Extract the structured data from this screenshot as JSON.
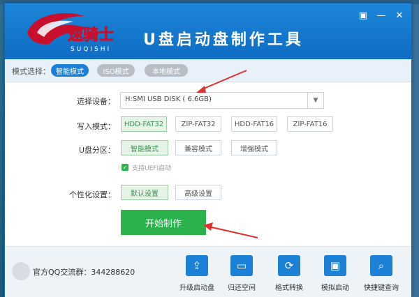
{
  "window": {
    "title": "U盘启动盘制作工具",
    "brand_text": "速骑士",
    "brand_sub": "SUQISHI",
    "controls": {
      "menu": "▣",
      "minimize": "—",
      "close": "✕"
    }
  },
  "mode_bar": {
    "label": "模式选择：",
    "tabs": [
      {
        "label": "智能模式",
        "active": true
      },
      {
        "label": "ISO模式",
        "active": false
      },
      {
        "label": "本地模式",
        "active": false
      }
    ]
  },
  "form": {
    "device_label": "选择设备：",
    "device_value": "H:SMI USB DISK ( 6.6GB)",
    "write_label": "写入模式：",
    "write_options": [
      "HDD-FAT32",
      "ZIP-FAT32",
      "HDD-FAT16",
      "ZIP-FAT16"
    ],
    "write_selected": "HDD-FAT32",
    "partition_label": "U盘分区：",
    "partition_options": [
      "智能模式",
      "兼容模式",
      "增强模式"
    ],
    "partition_selected": "智能模式",
    "uefi_label": "支持UEFI启动",
    "uefi_checked": true,
    "personal_label": "个性化设置：",
    "personal_options": [
      "默认设置",
      "高级设置"
    ],
    "personal_selected": "默认设置",
    "start_button": "开始制作"
  },
  "footer": {
    "qq_group": "官方QQ交流群：344288620",
    "tools": [
      {
        "label": "升级启动盘",
        "icon": "upgrade-icon"
      },
      {
        "label": "归还空间",
        "icon": "disk-icon"
      },
      {
        "label": "格式转换",
        "icon": "convert-icon"
      },
      {
        "label": "模拟启动",
        "icon": "monitor-icon"
      },
      {
        "label": "快捷键查询",
        "icon": "search-icon"
      }
    ]
  },
  "colors": {
    "header_blue": "#1d86d8",
    "accent_green": "#2bb24c",
    "arrow_red": "#e0302f"
  }
}
